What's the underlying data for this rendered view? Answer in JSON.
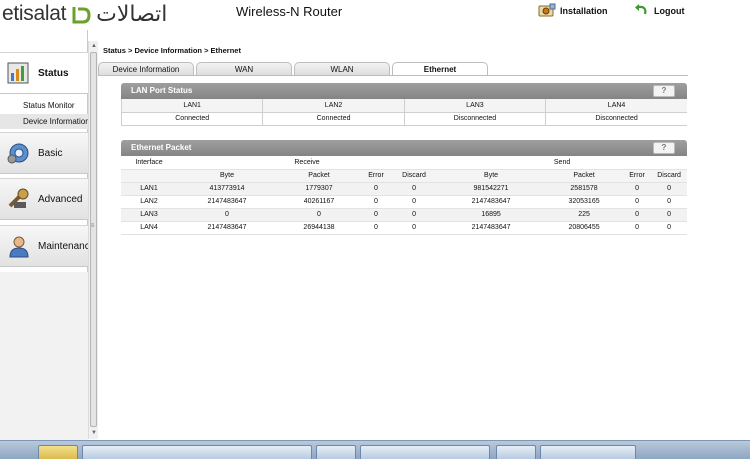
{
  "header": {
    "logo_en": "etisalat",
    "logo_ar": "اتصالات",
    "router_title": "Wireless-N Router",
    "installation_label": "Installation",
    "logout_label": "Logout"
  },
  "sidebar": {
    "sections": [
      {
        "label": "Status",
        "icon": "status-chart-icon",
        "active": true
      },
      {
        "label": "Basic",
        "icon": "basic-gear-icon",
        "active": false
      },
      {
        "label": "Advanced",
        "icon": "advanced-tools-icon",
        "active": false
      },
      {
        "label": "Maintenance",
        "icon": "maintenance-user-icon",
        "active": false
      }
    ],
    "status_items": [
      "Status Monitor",
      "Device Information"
    ]
  },
  "breadcrumb": "Status > Device Information > Ethernet",
  "tabs": [
    {
      "label": "Device Information",
      "active": false
    },
    {
      "label": "WAN",
      "active": false
    },
    {
      "label": "WLAN",
      "active": false
    },
    {
      "label": "Ethernet",
      "active": true
    }
  ],
  "lan_port_status": {
    "title": "LAN Port Status",
    "help": "?",
    "headers": [
      "LAN1",
      "LAN2",
      "LAN3",
      "LAN4"
    ],
    "values": [
      "Connected",
      "Connected",
      "Disconnected",
      "Disconnected"
    ]
  },
  "ethernet_packet": {
    "title": "Ethernet Packet",
    "help": "?",
    "interface_label": "Interface",
    "receive_label": "Receive",
    "send_label": "Send",
    "sub_headers": [
      "Byte",
      "Packet",
      "Error",
      "Discard",
      "Byte",
      "Packet",
      "Error",
      "Discard"
    ],
    "rows": [
      {
        "interface": "LAN1",
        "cells": [
          "413773914",
          "1779307",
          "0",
          "0",
          "981542271",
          "2581578",
          "0",
          "0"
        ]
      },
      {
        "interface": "LAN2",
        "cells": [
          "2147483647",
          "40261167",
          "0",
          "0",
          "2147483647",
          "32053165",
          "0",
          "0"
        ]
      },
      {
        "interface": "LAN3",
        "cells": [
          "0",
          "0",
          "0",
          "0",
          "16895",
          "225",
          "0",
          "0"
        ]
      },
      {
        "interface": "LAN4",
        "cells": [
          "2147483647",
          "26944138",
          "0",
          "0",
          "2147483647",
          "20806455",
          "0",
          "0"
        ]
      }
    ]
  },
  "colors": {
    "panel_header": "#8f8f8f",
    "taskbar": "#9fb4cd"
  }
}
